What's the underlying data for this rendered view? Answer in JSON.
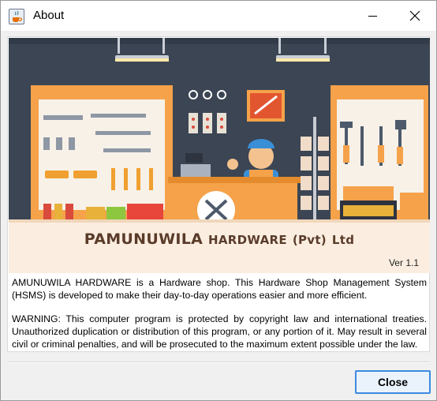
{
  "window": {
    "title": "About",
    "icon": "java-cup-icon",
    "controls": [
      "minimize-icon",
      "close-icon"
    ]
  },
  "banner": {
    "brand_main": "PAMUNUWILA",
    "brand_mid": "HARDWARE",
    "brand_pvt": "(Pvt)",
    "brand_ltd": "Ltd",
    "version": "Ver 1.1"
  },
  "content": {
    "description": "AMUNUWILA HARDWARE is a Hardware shop. This Hardware Shop Management System (HSMS) is developed to make their day-to-day operations easier and more efficient.",
    "warning": "WARNING: This computer program is protected by copyright law and international treaties. Unauthorized duplication or distribution of this program, or any portion of it. May result in several civil or criminal penalties, and will be prosecuted to the maximum extent possible under the law."
  },
  "footer": {
    "close_label": "Close"
  },
  "colors": {
    "accent": "#3c8ae0",
    "brand": "#5a3b2a",
    "banner_orange": "#f5a24a",
    "banner_panel": "#3f4a5a"
  }
}
